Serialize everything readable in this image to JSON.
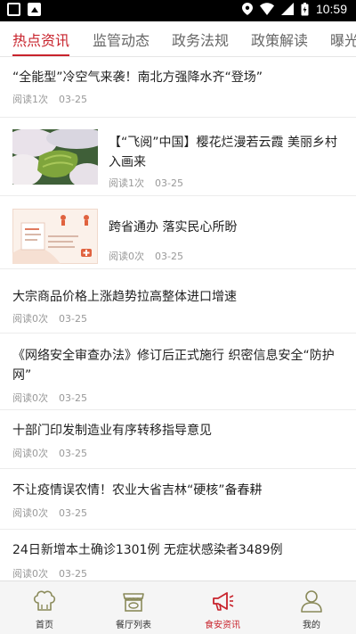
{
  "status_bar": {
    "time": "10:59"
  },
  "tabs": [
    {
      "label": "热点资讯",
      "active": true
    },
    {
      "label": "监管动态"
    },
    {
      "label": "政务法规"
    },
    {
      "label": "政策解读"
    },
    {
      "label": "曝光"
    }
  ],
  "news": [
    {
      "title": "“全能型”冷空气来袭！南北方强降水齐“登场”",
      "reads": "阅读1次",
      "date": "03-25"
    },
    {
      "title": "【“飞阅”中国】樱花烂漫若云霞 美丽乡村入画来",
      "reads": "阅读1次",
      "date": "03-25",
      "thumb_icon": "cherry-blossom-aerial-photo"
    },
    {
      "title": "跨省通办 落实民心所盼",
      "reads": "阅读0次",
      "date": "03-25",
      "thumb_icon": "service-guide-poster"
    },
    {
      "title": "大宗商品价格上涨趋势拉高整体进口增速",
      "reads": "阅读0次",
      "date": "03-25"
    },
    {
      "title": "《网络安全审查办法》修订后正式施行 织密信息安全“防护网”",
      "reads": "阅读0次",
      "date": "03-25"
    },
    {
      "title": "十部门印发制造业有序转移指导意见",
      "reads": "阅读0次",
      "date": "03-25"
    },
    {
      "title": "不让疫情误农情！农业大省吉林“硬核”备春耕",
      "reads": "阅读0次",
      "date": "03-25"
    },
    {
      "title": "24日新增本土确诊1301例 无症状感染者3489例",
      "reads": "阅读0次",
      "date": "03-25"
    }
  ],
  "bottom_nav": [
    {
      "label": "首页",
      "icon": "chef-hat-icon"
    },
    {
      "label": "餐厅列表",
      "icon": "restaurant-icon"
    },
    {
      "label": "食安资讯",
      "icon": "megaphone-icon",
      "active": true
    },
    {
      "label": "我的",
      "icon": "person-icon"
    }
  ],
  "colors": {
    "accent": "#c8232c"
  }
}
